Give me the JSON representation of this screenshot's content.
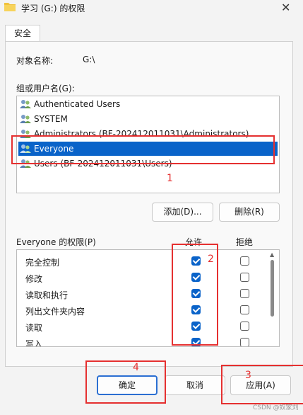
{
  "window": {
    "title": "学习 (G:) 的权限",
    "close_glyph": "✕"
  },
  "tabs": [
    {
      "label": "安全"
    }
  ],
  "object": {
    "label": "对象名称:",
    "value": "G:\\"
  },
  "groups": {
    "label": "组或用户名(G):",
    "items": [
      {
        "label": "Authenticated Users",
        "selected": false
      },
      {
        "label": "SYSTEM",
        "selected": false
      },
      {
        "label": "Administrators (BF-202412011031\\Administrators)",
        "selected": false
      },
      {
        "label": "Everyone",
        "selected": true
      },
      {
        "label": "Users (BF-202412011031\\Users)",
        "selected": false
      }
    ]
  },
  "buttons": {
    "add": "添加(D)...",
    "remove": "删除(R)",
    "ok": "确定",
    "cancel": "取消",
    "apply": "应用(A)"
  },
  "permissions": {
    "label": "Everyone 的权限(P)",
    "allow_header": "允许",
    "deny_header": "拒绝",
    "rows": [
      {
        "name": "完全控制",
        "allow": true,
        "deny": false
      },
      {
        "name": "修改",
        "allow": true,
        "deny": false
      },
      {
        "name": "读取和执行",
        "allow": true,
        "deny": false
      },
      {
        "name": "列出文件夹内容",
        "allow": true,
        "deny": false
      },
      {
        "name": "读取",
        "allow": true,
        "deny": false
      },
      {
        "name": "写入",
        "allow": true,
        "deny": false
      }
    ]
  },
  "annotations": [
    "1",
    "2",
    "3",
    "4"
  ],
  "watermark": "CSDN @奴家刘",
  "colors": {
    "selection": "#0a63c9",
    "annotation": "#e53030",
    "primary_border": "#2b6fd2"
  }
}
